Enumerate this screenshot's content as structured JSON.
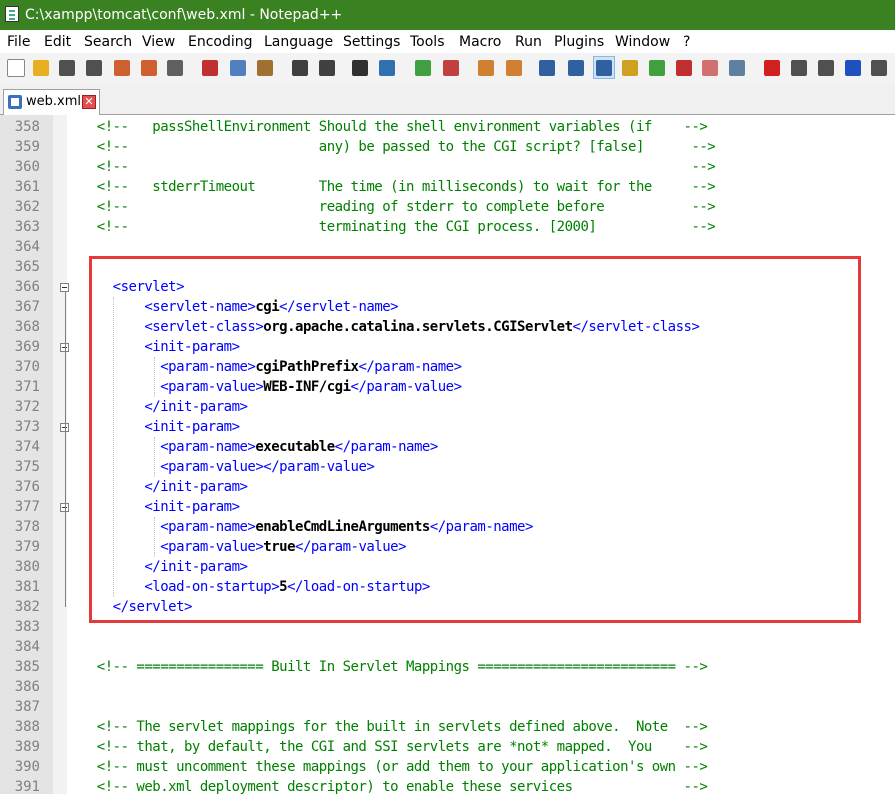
{
  "window": {
    "title": "C:\\xampp\\tomcat\\conf\\web.xml - Notepad++"
  },
  "menu": [
    "File",
    "Edit",
    "Search",
    "View",
    "Encoding",
    "Language",
    "Settings",
    "Tools",
    "Macro",
    "Run",
    "Plugins",
    "Window",
    "?"
  ],
  "toolbar": [
    {
      "name": "new-file-icon",
      "color": "#ffffff"
    },
    {
      "name": "open-file-icon",
      "color": "#e8b020"
    },
    {
      "name": "save-icon",
      "color": "#505050"
    },
    {
      "name": "save-all-icon",
      "color": "#505050"
    },
    {
      "name": "close-icon",
      "color": "#d06030"
    },
    {
      "name": "close-all-icon",
      "color": "#d06030"
    },
    {
      "name": "print-icon",
      "color": "#606060"
    },
    {
      "name": "cut-icon",
      "color": "#c03030"
    },
    {
      "name": "copy-icon",
      "color": "#5080c0"
    },
    {
      "name": "paste-icon",
      "color": "#a07030"
    },
    {
      "name": "undo-icon",
      "color": "#404040"
    },
    {
      "name": "redo-icon",
      "color": "#404040"
    },
    {
      "name": "find-icon",
      "color": "#303030"
    },
    {
      "name": "replace-icon",
      "color": "#3070b0"
    },
    {
      "name": "zoom-in-icon",
      "color": "#40a040"
    },
    {
      "name": "zoom-out-icon",
      "color": "#c04040"
    },
    {
      "name": "sync-vertical-icon",
      "color": "#d08030"
    },
    {
      "name": "sync-horizontal-icon",
      "color": "#d08030"
    },
    {
      "name": "word-wrap-icon",
      "color": "#3060a0"
    },
    {
      "name": "show-all-chars-icon",
      "color": "#3060a0"
    },
    {
      "name": "indent-guide-icon",
      "color": "#3060a0"
    },
    {
      "name": "udl-icon",
      "color": "#d0a020"
    },
    {
      "name": "doc-map-icon",
      "color": "#40a040"
    },
    {
      "name": "function-list-icon",
      "color": "#c03030"
    },
    {
      "name": "folder-workspace-icon",
      "color": "#d07070"
    },
    {
      "name": "monitoring-icon",
      "color": "#6080a0"
    },
    {
      "name": "record-macro-icon",
      "color": "#d02020"
    },
    {
      "name": "stop-record-icon",
      "color": "#505050"
    },
    {
      "name": "playback-icon",
      "color": "#505050"
    },
    {
      "name": "run-macro-multiple-icon",
      "color": "#2050c0"
    },
    {
      "name": "save-macro-icon",
      "color": "#505050"
    }
  ],
  "tab": {
    "label": "web.xml",
    "close_glyph": "✕"
  },
  "editor": {
    "lines": [
      {
        "n": "358",
        "text": "<!--   passShellEnvironment Should the shell environment variables (if    -->"
      },
      {
        "n": "359",
        "text": "<!--                        any) be passed to the CGI script? [false]      -->"
      },
      {
        "n": "360",
        "text": "<!--                                                                       -->"
      },
      {
        "n": "361",
        "text": "<!--   stderrTimeout        The time (in milliseconds) to wait for the     -->"
      },
      {
        "n": "362",
        "text": "<!--                        reading of stderr to complete before           -->"
      },
      {
        "n": "363",
        "text": "<!--                        terminating the CGI process. [2000]            -->"
      },
      {
        "n": "364",
        "text": ""
      },
      {
        "n": "365",
        "text": ""
      },
      {
        "n": "366",
        "open": "<servlet>"
      },
      {
        "n": "367",
        "open": "<servlet-name>",
        "value": "cgi",
        "close": "</servlet-name>"
      },
      {
        "n": "368",
        "open": "<servlet-class>",
        "value": "org.apache.catalina.servlets.CGIServlet",
        "close": "</servlet-class>"
      },
      {
        "n": "369",
        "open": "<init-param>"
      },
      {
        "n": "370",
        "open": "<param-name>",
        "value": "cgiPathPrefix",
        "close": "</param-name>"
      },
      {
        "n": "371",
        "open": "<param-value>",
        "value": "WEB-INF/cgi",
        "close": "</param-value>"
      },
      {
        "n": "372",
        "open": "</init-param>"
      },
      {
        "n": "373",
        "open": "<init-param>"
      },
      {
        "n": "374",
        "open": "<param-name>",
        "value": "executable",
        "close": "</param-name>"
      },
      {
        "n": "375",
        "open": "<param-value>",
        "value": "",
        "close": "</param-value>"
      },
      {
        "n": "376",
        "open": "</init-param>"
      },
      {
        "n": "377",
        "open": "<init-param>"
      },
      {
        "n": "378",
        "open": "<param-name>",
        "value": "enableCmdLineArguments",
        "close": "</param-name>"
      },
      {
        "n": "379",
        "open": "<param-value>",
        "value": "true",
        "close": "</param-value>"
      },
      {
        "n": "380",
        "open": "</init-param>"
      },
      {
        "n": "381",
        "open": "<load-on-startup>",
        "value": "5",
        "close": "</load-on-startup>"
      },
      {
        "n": "382",
        "open": "</servlet>"
      },
      {
        "n": "383",
        "text": ""
      },
      {
        "n": "384",
        "text": ""
      },
      {
        "n": "385",
        "text": "<!-- ================ Built In Servlet Mappings ========================= -->"
      },
      {
        "n": "386",
        "text": ""
      },
      {
        "n": "387",
        "text": ""
      },
      {
        "n": "388",
        "text": "<!-- The servlet mappings for the built in servlets defined above.  Note  -->"
      },
      {
        "n": "389",
        "text": "<!-- that, by default, the CGI and SSI servlets are *not* mapped.  You    -->"
      },
      {
        "n": "390",
        "text": "<!-- must uncomment these mappings (or add them to your application's own -->"
      },
      {
        "n": "391",
        "text": "<!-- web.xml deployment descriptor) to enable these services              -->"
      }
    ]
  },
  "colors": {
    "titlebar": "#3a8121",
    "comment": "#008000",
    "tag": "#0000ff",
    "highlight_box": "#e63a3a"
  }
}
